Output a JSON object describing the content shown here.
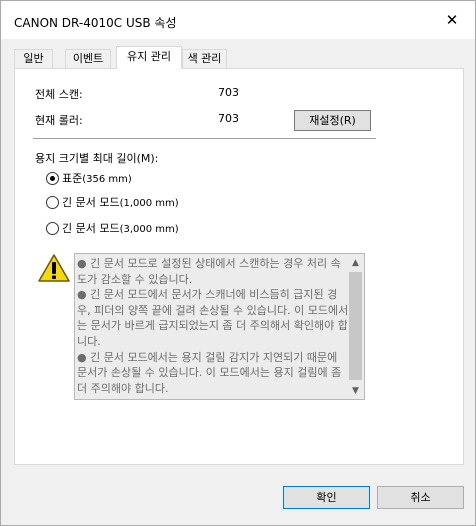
{
  "window": {
    "title": "CANON DR-4010C USB 속성",
    "close_glyph": "✕"
  },
  "tabs": [
    {
      "label": "일반"
    },
    {
      "label": "이벤트"
    },
    {
      "label": "유지 관리",
      "active": true
    },
    {
      "label": "색 관리"
    }
  ],
  "counters": {
    "total_scan_label": "전체 스캔:",
    "total_scan_value": "703",
    "current_roller_label": "현재 롤러:",
    "current_roller_value": "703",
    "reset_button": "재설정(R)"
  },
  "max_length": {
    "label": "용지 크기별 최대 길이(M):",
    "options": [
      {
        "label": "표준",
        "suffix": "(356 mm)",
        "checked": true
      },
      {
        "label": "긴 문서 모드",
        "suffix": "(1,000 mm)",
        "checked": false
      },
      {
        "label": "긴 문서 모드",
        "suffix": "(3,000 mm)",
        "checked": false
      }
    ]
  },
  "warning": {
    "icon": "warning-icon",
    "text": "● 긴 문서 모드로 설정된 상태에서 스캔하는 경우 처리 속도가 감소할 수 있습니다.\n● 긴 문서 모드에서 문서가 스캐너에 비스듬히 급지된 경우, 피더의 양쪽 끝에 걸려 손상될 수 있습니다. 이 모드에서는 문서가 바르게 급지되었는지 좀 더 주의해서 확인해야 합니다.\n● 긴 문서 모드에서는 용지 걸림 감지가 지연되기 때문에 문서가 손상될 수 있습니다. 이 모드에서는 용지 걸림에 좀 더 주의해야 합니다."
  },
  "footer": {
    "ok": "확인",
    "cancel": "취소"
  },
  "colors": {
    "accent": "#0078d7",
    "panel_bg": "#ffffff",
    "window_bg": "#f0f0f0"
  }
}
